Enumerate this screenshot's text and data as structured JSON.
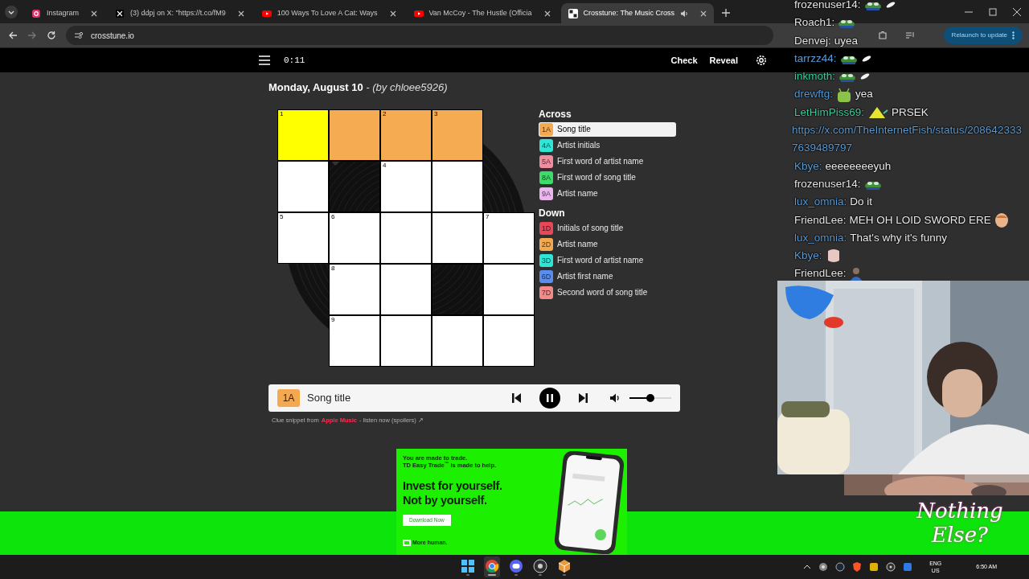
{
  "browser": {
    "tabs": [
      {
        "title": "Instagram",
        "kind": "instagram",
        "selected": false,
        "audio": false
      },
      {
        "title": "(3) ddpj on X: \"https://t.co/fM9",
        "kind": "x",
        "selected": false,
        "audio": false
      },
      {
        "title": "100 Ways To Love A Cat: Ways",
        "kind": "youtube",
        "selected": false,
        "audio": false
      },
      {
        "title": "Van McCoy - The Hustle (Officia",
        "kind": "youtube",
        "selected": false,
        "audio": false
      },
      {
        "title": "Crosstune: The Music Cross",
        "kind": "crosstune",
        "selected": true,
        "audio": true
      }
    ],
    "url": "crosstune.io",
    "update_button": "Relaunch to update"
  },
  "app": {
    "timer": "0:11",
    "actions": [
      "Check",
      "Reveal"
    ],
    "date": "Monday, August 10",
    "byline": "- (by chloee5926)"
  },
  "grid": [
    [
      {
        "kind": "letter",
        "cursor": true,
        "in_word": true,
        "number": "1"
      },
      {
        "kind": "letter",
        "cursor": false,
        "in_word": true
      },
      {
        "kind": "letter",
        "cursor": false,
        "in_word": true,
        "number": "2"
      },
      {
        "kind": "letter",
        "cursor": false,
        "in_word": true,
        "number": "3"
      },
      {
        "kind": "none"
      }
    ],
    [
      {
        "kind": "letter",
        "cursor": false,
        "in_word": false
      },
      {
        "kind": "block"
      },
      {
        "kind": "letter",
        "cursor": false,
        "in_word": false,
        "number": "4"
      },
      {
        "kind": "letter",
        "cursor": false,
        "in_word": false
      },
      {
        "kind": "none"
      }
    ],
    [
      {
        "kind": "letter",
        "cursor": false,
        "in_word": false,
        "number": "5"
      },
      {
        "kind": "letter",
        "cursor": false,
        "in_word": false,
        "number": "6"
      },
      {
        "kind": "letter",
        "cursor": false,
        "in_word": false
      },
      {
        "kind": "letter",
        "cursor": false,
        "in_word": false
      },
      {
        "kind": "letter",
        "cursor": false,
        "in_word": false,
        "number": "7"
      }
    ],
    [
      {
        "kind": "none"
      },
      {
        "kind": "letter",
        "cursor": false,
        "in_word": false,
        "number": "8"
      },
      {
        "kind": "letter",
        "cursor": false,
        "in_word": false
      },
      {
        "kind": "block"
      },
      {
        "kind": "letter",
        "cursor": false,
        "in_word": false
      }
    ],
    [
      {
        "kind": "none"
      },
      {
        "kind": "letter",
        "cursor": false,
        "in_word": false,
        "number": "9"
      },
      {
        "kind": "letter",
        "cursor": false,
        "in_word": false
      },
      {
        "kind": "letter",
        "cursor": false,
        "in_word": false
      },
      {
        "kind": "letter",
        "cursor": false,
        "in_word": false
      }
    ]
  ],
  "clues": {
    "across_heading": "Across",
    "across": [
      {
        "label": "1A",
        "text": "Song title",
        "color": "#f4a950",
        "selected": true
      },
      {
        "label": "4A",
        "text": "Artist initials",
        "color": "#2ee6d6",
        "selected": false
      },
      {
        "label": "5A",
        "text": "First word of artist name",
        "color": "#f28da0",
        "selected": false
      },
      {
        "label": "8A",
        "text": "First word of song title",
        "color": "#3ddc6a",
        "selected": false
      },
      {
        "label": "9A",
        "text": "Artist name",
        "color": "#ebb6ee",
        "selected": false
      }
    ],
    "down_heading": "Down",
    "down": [
      {
        "label": "1D",
        "text": "Initials of song title",
        "color": "#e8475a",
        "selected": false
      },
      {
        "label": "2D",
        "text": "Artist name",
        "color": "#f4a950",
        "selected": false
      },
      {
        "label": "3D",
        "text": "First word of artist name",
        "color": "#2ee6d6",
        "selected": false
      },
      {
        "label": "6D",
        "text": "Artist first name",
        "color": "#5b8def",
        "selected": false
      },
      {
        "label": "7D",
        "text": "Second word of song title",
        "color": "#f28a8a",
        "selected": false
      }
    ]
  },
  "player": {
    "clue_label": "1A",
    "clue_text": "Song title",
    "playing": true,
    "volume": {
      "level": 0.5
    }
  },
  "attribution": {
    "prefix": "Clue snippet from",
    "source": "Apple Music",
    "suffix": "- listen now (spoilers) ↗"
  },
  "ad": {
    "intro": "You are made to trade.",
    "intro_2": "TD Easy Trade$^{™}$ is made to help.",
    "headline": [
      "Invest for yourself.",
      "Not by yourself."
    ],
    "button": "Download Now",
    "tagline": "More human."
  },
  "chat": [
    {
      "kind": "message",
      "user": "frozenuser14:",
      "color": "#e6e6e6",
      "parts": [
        {
          "kind": "frog"
        },
        {
          "kind": "feather"
        }
      ]
    },
    {
      "kind": "message",
      "user": "Roach1:",
      "color": "#e6e6e6",
      "parts": [
        {
          "kind": "frog"
        }
      ]
    },
    {
      "kind": "message",
      "user": "Denvej:",
      "color": "#e6e6e6",
      "parts": [
        {
          "kind": "text",
          "text": "uyea"
        }
      ]
    },
    {
      "kind": "message",
      "user": "tarrzz44:",
      "color": "#5b9bd5",
      "parts": [
        {
          "kind": "frog"
        },
        {
          "kind": "feather"
        }
      ]
    },
    {
      "kind": "message",
      "user": "inkmoth:",
      "color": "#3fcf9a",
      "parts": [
        {
          "kind": "frog"
        },
        {
          "kind": "feather"
        }
      ]
    },
    {
      "kind": "message",
      "user": "drewftg:",
      "color": "#5b9bd5",
      "parts": [
        {
          "kind": "robot"
        },
        {
          "kind": "text",
          "text": "yea"
        }
      ]
    },
    {
      "kind": "message",
      "user": "LetHimPiss69:",
      "color": "#3fcf9a",
      "parts": [
        {
          "kind": "triangle"
        },
        {
          "kind": "text",
          "text": "PRSEK"
        }
      ]
    },
    {
      "kind": "link",
      "text": "https://x.com/TheInternetFish/status/2086423337639489797"
    },
    {
      "kind": "message",
      "user": "Kbye:",
      "color": "#5b9bd5",
      "parts": [
        {
          "kind": "text",
          "text": "eeeeeeeeyuh"
        }
      ]
    },
    {
      "kind": "message",
      "user": "frozenuser14:",
      "color": "#e6e6e6",
      "parts": [
        {
          "kind": "frog"
        }
      ]
    },
    {
      "kind": "message",
      "user": "lux_omnia:",
      "color": "#5b9bd5",
      "parts": [
        {
          "kind": "text",
          "text": "Do it"
        }
      ]
    },
    {
      "kind": "message",
      "user": "FriendLee:",
      "color": "#e6e6e6",
      "parts": [
        {
          "kind": "text",
          "text": "MEH OH LOID SWORD ERE"
        },
        {
          "kind": "head"
        }
      ]
    },
    {
      "kind": "message",
      "user": "lux_omnia:",
      "color": "#5b9bd5",
      "parts": [
        {
          "kind": "text",
          "text": "That's why it's funny"
        }
      ]
    },
    {
      "kind": "message",
      "user": "Kbye:",
      "color": "#5b9bd5",
      "parts": [
        {
          "kind": "fist"
        }
      ]
    },
    {
      "kind": "message",
      "user": "FriendLee:",
      "color": "#e6e6e6",
      "parts": [
        {
          "kind": "figure"
        }
      ]
    }
  ],
  "overlay": {
    "logo_text": "Nothing Else?"
  },
  "taskbar": {
    "apps": [
      {
        "kind": "windows",
        "selected": false
      },
      {
        "kind": "chrome",
        "selected": true
      },
      {
        "kind": "discord",
        "selected": false
      },
      {
        "kind": "obs",
        "selected": false
      },
      {
        "kind": "cube",
        "selected": false
      }
    ],
    "language": "ENG",
    "region": "US",
    "time": "6:50 AM"
  }
}
